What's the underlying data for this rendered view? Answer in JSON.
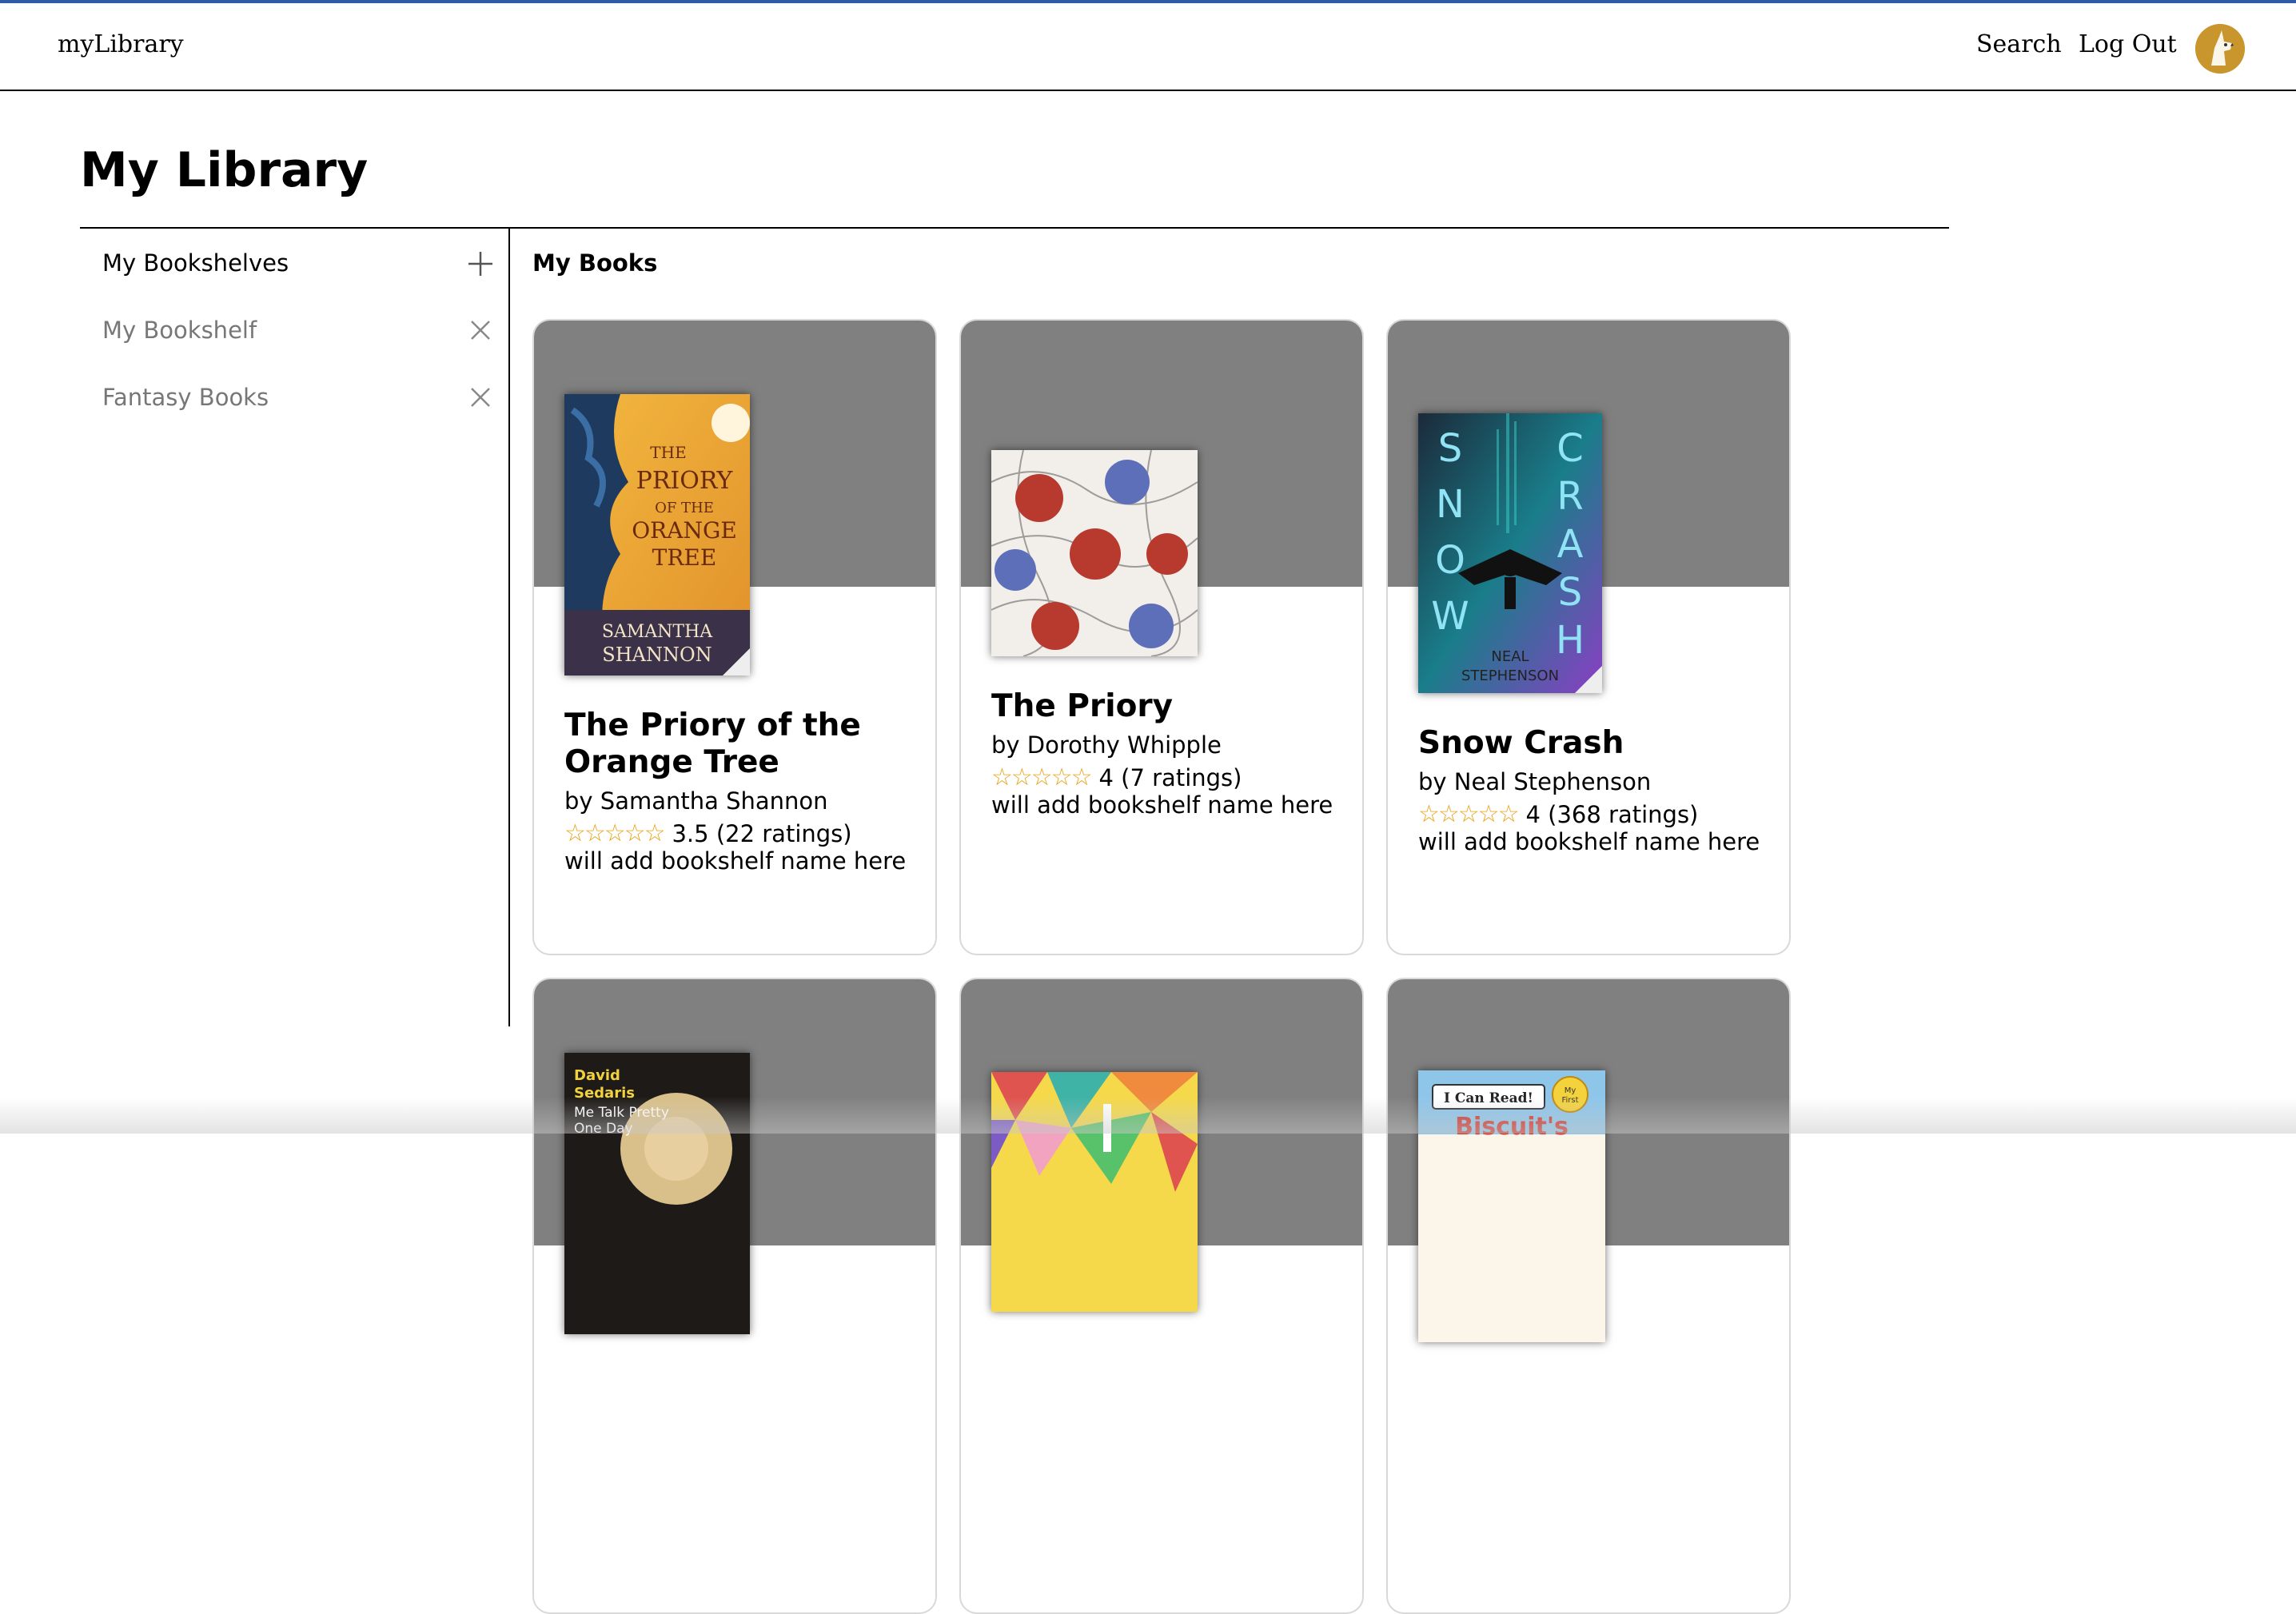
{
  "nav": {
    "brand": "myLibrary",
    "search_label": "Search",
    "logout_label": "Log Out",
    "avatar_icon": "dog-avatar-icon"
  },
  "page": {
    "title": "My Library"
  },
  "sidebar": {
    "header": "My Bookshelves",
    "add_icon": "plus-icon",
    "items": [
      {
        "label": "My Bookshelf",
        "icon": "close-icon"
      },
      {
        "label": "Fantasy Books",
        "icon": "close-icon"
      }
    ]
  },
  "main": {
    "header": "My Books",
    "books": [
      {
        "title": "The Priory of the Orange Tree",
        "author": "by Samantha Shannon",
        "stars": "☆☆☆☆☆",
        "rating": "3.5 (22 ratings)",
        "shelf": "will add bookshelf name here",
        "cover": {
          "top_text": "THE PRIORY OF THE ORANGE TREE",
          "bottom_text": "SAMANTHA SHANNON"
        }
      },
      {
        "title": "The Priory",
        "author": "by Dorothy Whipple",
        "stars": "☆☆☆☆☆",
        "rating": "4 (7 ratings)",
        "shelf": "will add bookshelf name here"
      },
      {
        "title": "Snow Crash",
        "author": "by Neal Stephenson",
        "stars": "☆☆☆☆☆",
        "rating": "4 (368 ratings)",
        "shelf": "will add bookshelf name here",
        "cover": {
          "left_text": "SNOW",
          "right_text": "CRASH",
          "bottom_text": "NEAL STEPHENSON"
        }
      },
      {
        "cover": {
          "author_text": "David Sedaris",
          "title_text": "Me Talk Pretty One Day"
        }
      },
      {},
      {
        "cover": {
          "series_text": "I Can Read!",
          "badge_text": "My First",
          "title_text": "Biscuit's"
        }
      }
    ]
  },
  "colors": {
    "topline": "#2f5ba8",
    "card_banner": "#808080",
    "star": "#e8a317",
    "sidebar_item": "#777777"
  }
}
